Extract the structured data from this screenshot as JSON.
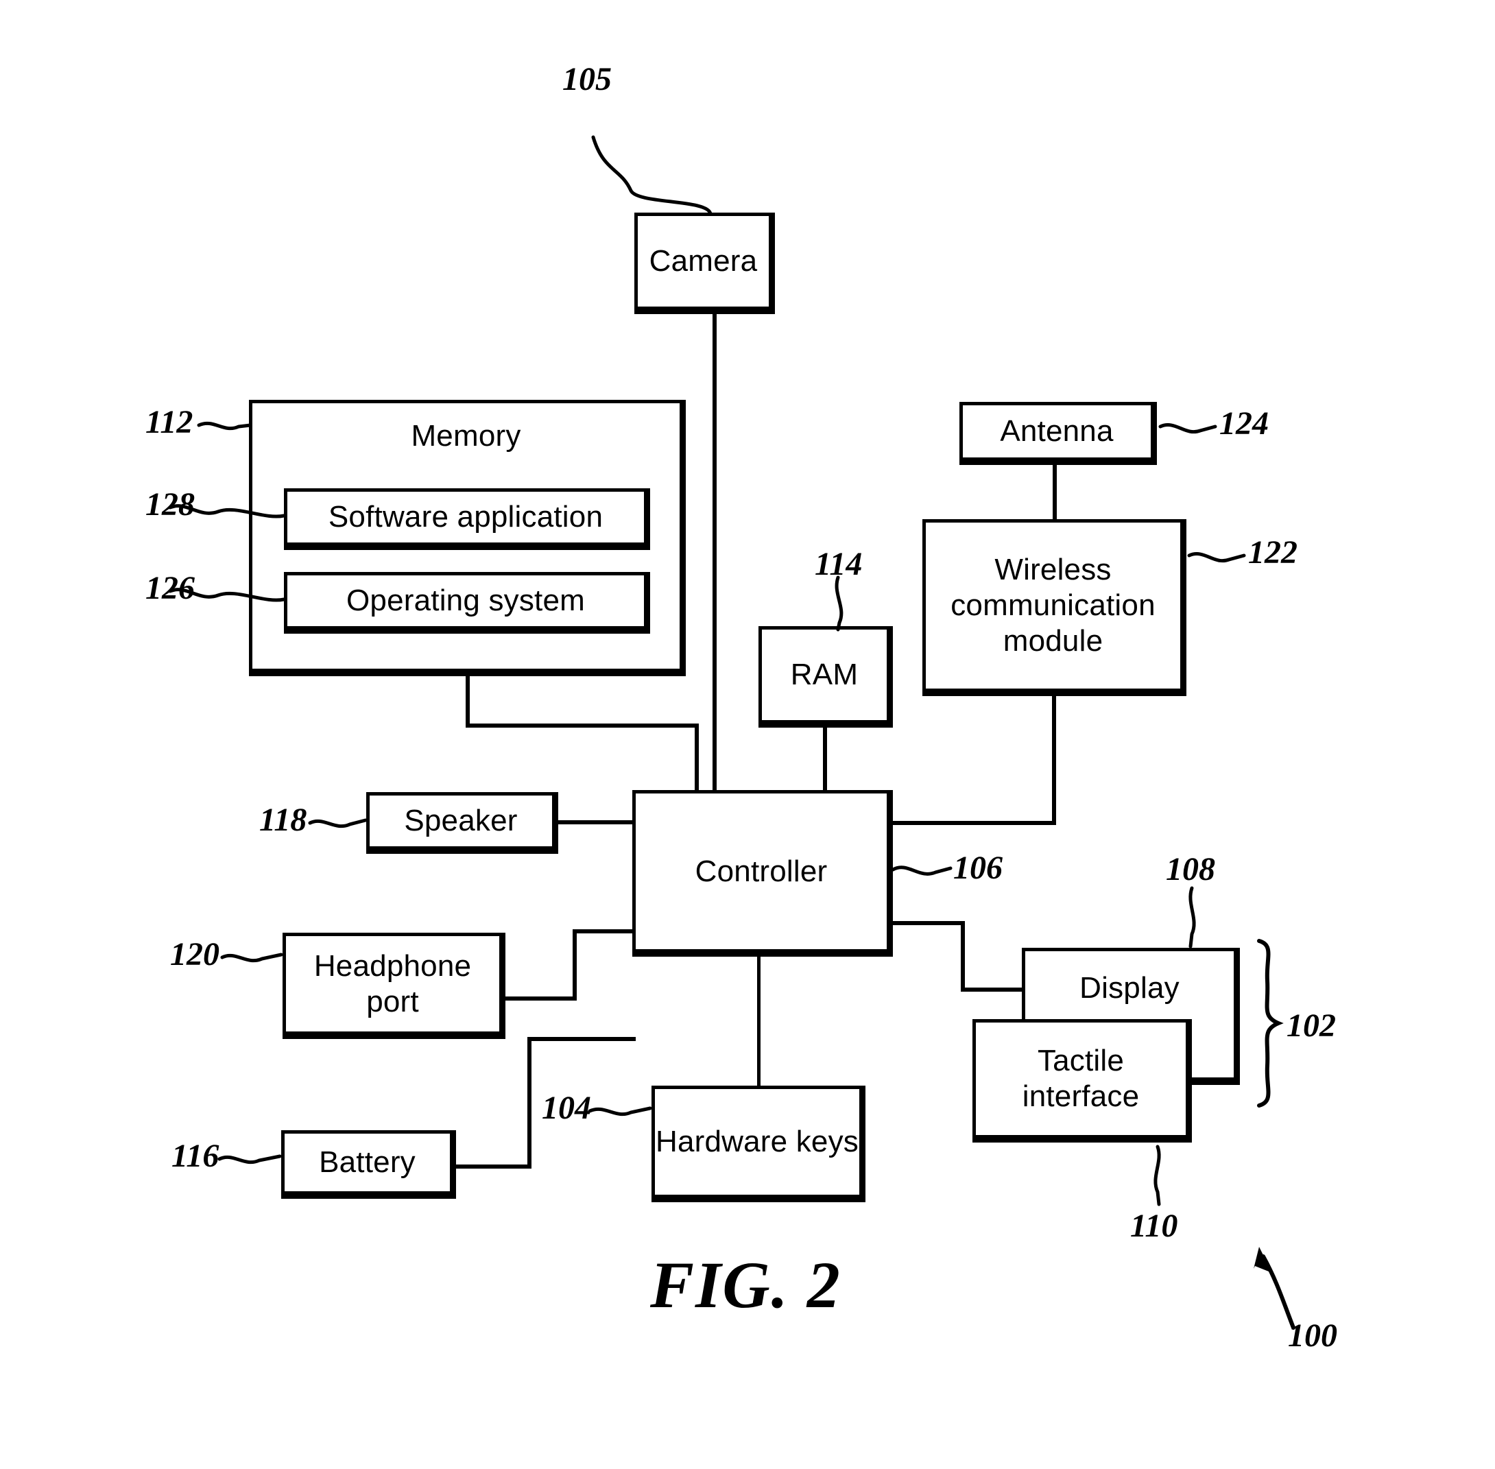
{
  "figure": {
    "caption": "FIG. 2",
    "device_ref": "100"
  },
  "blocks": {
    "camera": {
      "label": "Camera",
      "ref": "105"
    },
    "memory": {
      "label": "Memory",
      "ref": "112"
    },
    "software": {
      "label": "Software application",
      "ref": "128"
    },
    "os": {
      "label": "Operating system",
      "ref": "126"
    },
    "antenna": {
      "label": "Antenna",
      "ref": "124"
    },
    "wireless": {
      "label": "Wireless communication module",
      "ref": "122"
    },
    "ram": {
      "label": "RAM",
      "ref": "114"
    },
    "controller": {
      "label": "Controller",
      "ref": "106"
    },
    "speaker": {
      "label": "Speaker",
      "ref": "118"
    },
    "headphone": {
      "label": "Headphone port",
      "ref": "120"
    },
    "battery": {
      "label": "Battery",
      "ref": "116"
    },
    "hardware_keys": {
      "label": "Hardware keys",
      "ref": "104"
    },
    "display": {
      "label": "Display",
      "ref": "108"
    },
    "tactile": {
      "label": "Tactile interface",
      "ref": "110"
    },
    "user_interface_group": {
      "ref": "102"
    }
  }
}
